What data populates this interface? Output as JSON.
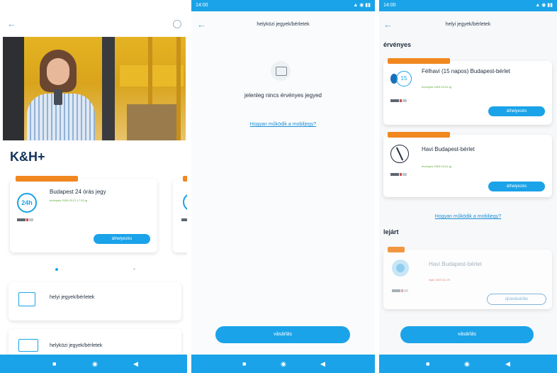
{
  "screen1": {
    "brand": "K&H+",
    "slides": [
      {
        "badge": "",
        "title": "Budapest 24 órás jegy",
        "validity": "érvényes 2020.03.21 17:33-ig",
        "action": "áthelyezés",
        "icon_text": "24h"
      }
    ],
    "carousel": {
      "active_index": 0
    },
    "menu": [
      {
        "title": "helyi jegyek/bérletek",
        "subtitle": ""
      },
      {
        "title": "helyközi jegyek/bérletek",
        "subtitle": ""
      }
    ]
  },
  "screen2": {
    "status_time": "14:00",
    "title": "helyközi jegyek/bérletek",
    "empty_text": "jelenleg nincs érvényes jegyed",
    "help_link": "Hogyan működik a mobiljegy?",
    "button": "vásárlás"
  },
  "screen3": {
    "status_time": "14:00",
    "title": "helyi jegyek/bérletek",
    "valid_heading": "érvényes",
    "expired_heading": "lejárt",
    "valid_tickets": [
      {
        "badge": "",
        "title": "Félhavi (15 napos) Budapest-bérlet",
        "subtitle": "",
        "validity": "érvényes 2020.03.31-ig",
        "action": "áthelyezés",
        "icon_text": "15"
      },
      {
        "badge": "",
        "title": "Havi Budapest-bérlet",
        "subtitle": "",
        "validity": "érvényes 2020.03.31-ig",
        "action": "áthelyezés",
        "icon_text": ""
      }
    ],
    "help_link": "Hogyan működik a mobiljegy?",
    "expired_tickets": [
      {
        "badge": "",
        "title": "Havi Budapest-bérlet",
        "validity": "lejárt 2020.02.29",
        "action": "újravásárlás"
      }
    ],
    "button": "vásárlás"
  },
  "colors": {
    "accent": "#1aa3e8",
    "badge": "#f0871f",
    "valid": "#5aa832",
    "expired": "#e06a5a"
  }
}
